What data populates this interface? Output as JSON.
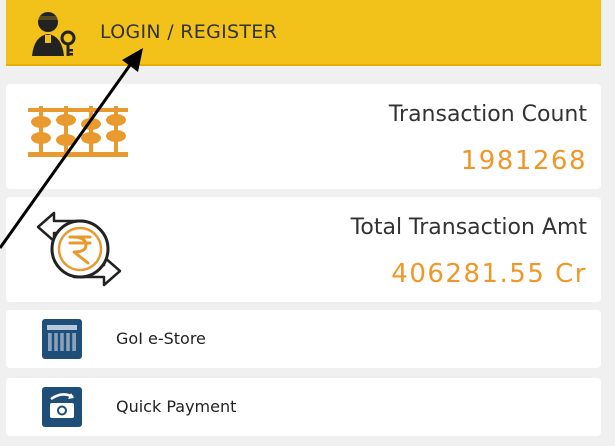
{
  "login": {
    "label": "LOGIN / REGISTER",
    "icon": "user-key-icon"
  },
  "stats": {
    "count": {
      "label": "Transaction Count",
      "value": "1981268",
      "icon": "abacus-icon"
    },
    "amount": {
      "label": "Total Transaction Amt",
      "value": "406281.55 Cr",
      "icon": "rupee-exchange-icon"
    }
  },
  "links": {
    "estore": {
      "label": "GoI e-Store",
      "icon": "store-icon"
    },
    "payment": {
      "label": "Quick Payment",
      "icon": "payment-icon"
    }
  },
  "colors": {
    "header_bg": "#f2c21b",
    "value_orange": "#f0972a",
    "icon_blue": "#1f4e79",
    "abacus_orange": "#e89a2e"
  }
}
